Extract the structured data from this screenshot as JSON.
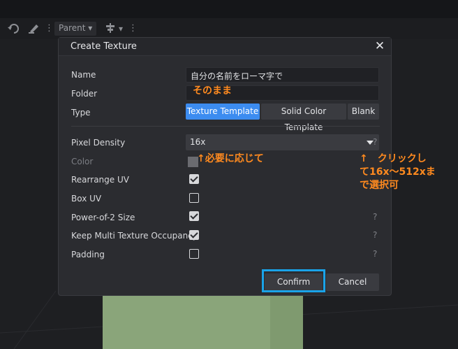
{
  "toolbar": {
    "parent_label": "Parent"
  },
  "dialog": {
    "title": "Create Texture",
    "close_glyph": "✕",
    "labels": {
      "name": "Name",
      "folder": "Folder",
      "type": "Type",
      "pixel_density": "Pixel Density",
      "color": "Color",
      "rearrange_uv": "Rearrange UV",
      "box_uv": "Box UV",
      "power_of_2": "Power-of-2 Size",
      "keep_multi": "Keep Multi Texture Occupancy",
      "padding": "Padding"
    },
    "name_value": "自分の名前をローマ字で",
    "folder_value": "",
    "type_options": [
      "Texture Template",
      "Solid Color Template",
      "Blank"
    ],
    "type_selected": "Texture Template",
    "pixel_density_value": "16x",
    "help_glyph": "?",
    "checkboxes": {
      "rearrange_uv": true,
      "box_uv": false,
      "power_of_2": true,
      "keep_multi": true,
      "padding": false
    },
    "confirm_label": "Confirm",
    "cancel_label": "Cancel"
  },
  "annotations": {
    "folder_note": "そのまま",
    "color_note": "↑必要に応じて",
    "density_note_1": "↑　クリックし",
    "density_note_2": "て16x～512xま",
    "density_note_3": "で選択可"
  },
  "colors": {
    "accent": "#3c8cf0",
    "annotation": "#ff8a1f",
    "highlight_frame": "#1aa3e8"
  }
}
